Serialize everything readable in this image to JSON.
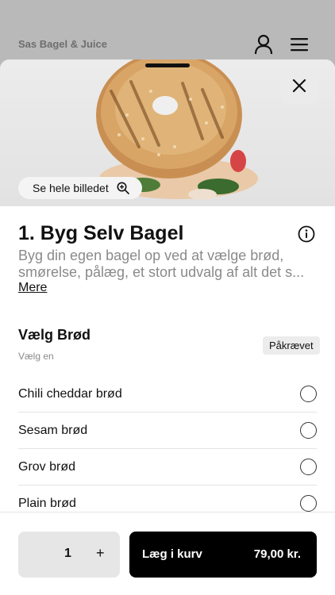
{
  "header": {
    "shop_name": "Sas Bagel & Juice",
    "user_icon": "user-icon",
    "menu_icon": "hamburger-menu-icon"
  },
  "hero": {
    "see_image_label": "Se hele billedet",
    "see_image_icon": "zoom-in-icon",
    "close_icon": "close-icon"
  },
  "product": {
    "title": "1. Byg Selv Bagel",
    "description_line1": "Byg din egen bagel op ved at vælge brød,",
    "description_line2": "smørelse, pålæg, et stort udvalg af alt det s...",
    "more_label": "Mere",
    "info_icon": "info-icon"
  },
  "bread_group": {
    "title": "Vælg Brød",
    "subtitle": "Vælg en",
    "badge": "Påkrævet",
    "options": [
      {
        "label": "Chili cheddar brød"
      },
      {
        "label": "Sesam brød"
      },
      {
        "label": "Grov brød"
      },
      {
        "label": "Plain brød"
      }
    ]
  },
  "footer": {
    "quantity": "1",
    "plus_label": "+",
    "add_label": "Læg i kurv",
    "price": "79,00 kr."
  }
}
